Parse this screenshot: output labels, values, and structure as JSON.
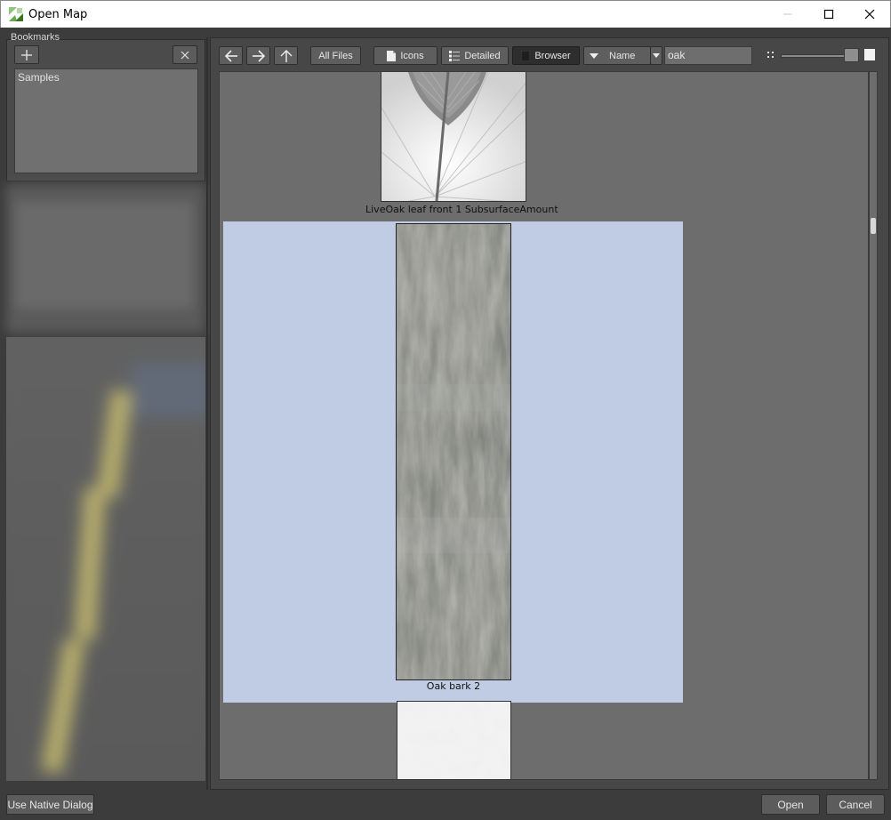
{
  "window": {
    "title": "Open Map",
    "icon": "app-icon",
    "controls": [
      "minimize-icon",
      "maximize-icon",
      "close-icon"
    ]
  },
  "bookmarks": {
    "label": "Bookmarks",
    "add_icon": "plus-icon",
    "remove_icon": "close-icon",
    "items": [
      {
        "label": "Samples"
      }
    ]
  },
  "toolbar": {
    "back_icon": "arrow-left-icon",
    "forward_icon": "arrow-right-icon",
    "up_icon": "arrow-up-icon",
    "filter_label": "All Files",
    "icons_label": "Icons",
    "detailed_label": "Detailed",
    "browser_label": "Browser",
    "sort_label": "Name",
    "search_value": "oak",
    "slider_value": 0.85
  },
  "browser": {
    "items": [
      {
        "caption": "LiveOak leaf front 1 SubsurfaceAmount",
        "selected": false
      },
      {
        "caption": "Oak bark 2",
        "selected": true
      },
      {
        "caption": "",
        "selected": false
      }
    ]
  },
  "footer": {
    "native_dialog_label": "Use Native Dialog",
    "open_label": "Open",
    "cancel_label": "Cancel"
  },
  "colors": {
    "selection": "#c0cce4",
    "panel": "#474747",
    "browser_bg": "#6d6d6d"
  }
}
